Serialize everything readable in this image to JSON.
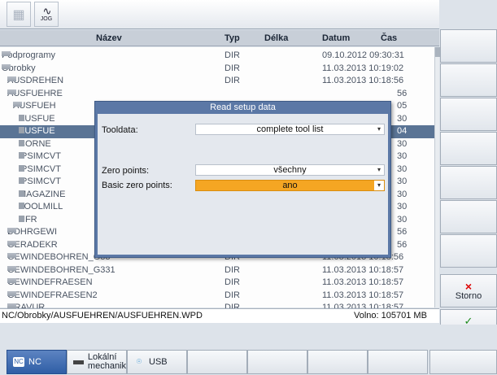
{
  "header": {
    "name": "Název",
    "type": "Typ",
    "length": "Délka",
    "date": "Datum",
    "time": "Čas"
  },
  "jog_label": "JOG",
  "rows": [
    {
      "name": "Podprogramy",
      "type": "DIR",
      "datetime": "09.10.2012 09:30:31",
      "indent": 0,
      "ex": "+"
    },
    {
      "name": "Obrobky",
      "type": "DIR",
      "datetime": "11.03.2013 10:19:02",
      "indent": 0,
      "ex": "−"
    },
    {
      "name": "AUSDREHEN",
      "type": "DIR",
      "datetime": "11.03.2013 10:18:56",
      "indent": 1,
      "ex": "+"
    },
    {
      "name": "AUSFUEHRE",
      "type": "",
      "datetime": "56",
      "indent": 1,
      "ex": "−"
    },
    {
      "name": "AUSFUEH",
      "type": "",
      "datetime": "05",
      "indent": 2,
      "ex": "+"
    },
    {
      "name": "AUSFUE",
      "type": "",
      "datetime": "30",
      "indent": 3,
      "ex": ""
    },
    {
      "name": "AUSFUE",
      "type": "",
      "datetime": "04",
      "indent": 3,
      "ex": "",
      "selected": true
    },
    {
      "name": "CORNE",
      "type": "",
      "datetime": "30",
      "indent": 3,
      "ex": ""
    },
    {
      "name": "IPSIMCVT",
      "type": "",
      "datetime": "30",
      "indent": 3,
      "ex": ""
    },
    {
      "name": "IPSIMCVT",
      "type": "",
      "datetime": "30",
      "indent": 3,
      "ex": ""
    },
    {
      "name": "IPSIMCVT",
      "type": "",
      "datetime": "30",
      "indent": 3,
      "ex": ""
    },
    {
      "name": "MAGAZINE",
      "type": "",
      "datetime": "30",
      "indent": 3,
      "ex": ""
    },
    {
      "name": "TOOLMILL",
      "type": "",
      "datetime": "30",
      "indent": 3,
      "ex": ""
    },
    {
      "name": "UFR",
      "type": "",
      "datetime": "30",
      "indent": 3,
      "ex": ""
    },
    {
      "name": "BOHRGEWI",
      "type": "",
      "datetime": "56",
      "indent": 1,
      "ex": "+"
    },
    {
      "name": "GERADEKR",
      "type": "",
      "datetime": "56",
      "indent": 1,
      "ex": "+"
    },
    {
      "name": "GEWINDEBOHREN_G33",
      "type": "DIR",
      "datetime": "11.03.2013 10:18:56",
      "indent": 1,
      "ex": "+"
    },
    {
      "name": "GEWINDEBOHREN_G331",
      "type": "DIR",
      "datetime": "11.03.2013 10:18:57",
      "indent": 1,
      "ex": "+"
    },
    {
      "name": "GEWINDEFRAESEN",
      "type": "DIR",
      "datetime": "11.03.2013 10:18:57",
      "indent": 1,
      "ex": "+"
    },
    {
      "name": "GEWINDEFRAESEN2",
      "type": "DIR",
      "datetime": "11.03.2013 10:18:57",
      "indent": 1,
      "ex": "+"
    },
    {
      "name": "GRAVUR",
      "type": "DIR",
      "datetime": "11.03.2013 10:18:57",
      "indent": 1,
      "ex": "+"
    }
  ],
  "status": {
    "path": "NC/Obrobky/AUSFUEHREN/AUSFUEHREN.WPD",
    "free": "Volno: 105701 MB"
  },
  "dialog": {
    "title": "Read setup data",
    "tooldata_label": "Tooldata:",
    "tooldata_value": "complete tool list",
    "zero_label": "Zero points:",
    "zero_value": "všechny",
    "basic_label": "Basic zero points:",
    "basic_value": "ano",
    "arrow": "▾"
  },
  "softkeys": {
    "cancel": "Storno",
    "cancel_mark": "×",
    "ok": "OK",
    "ok_mark": "✓"
  },
  "bottom_keys": {
    "nc": "NC",
    "local_line1": "Lokální",
    "local_line2": "mechanik",
    "usb": "USB"
  }
}
